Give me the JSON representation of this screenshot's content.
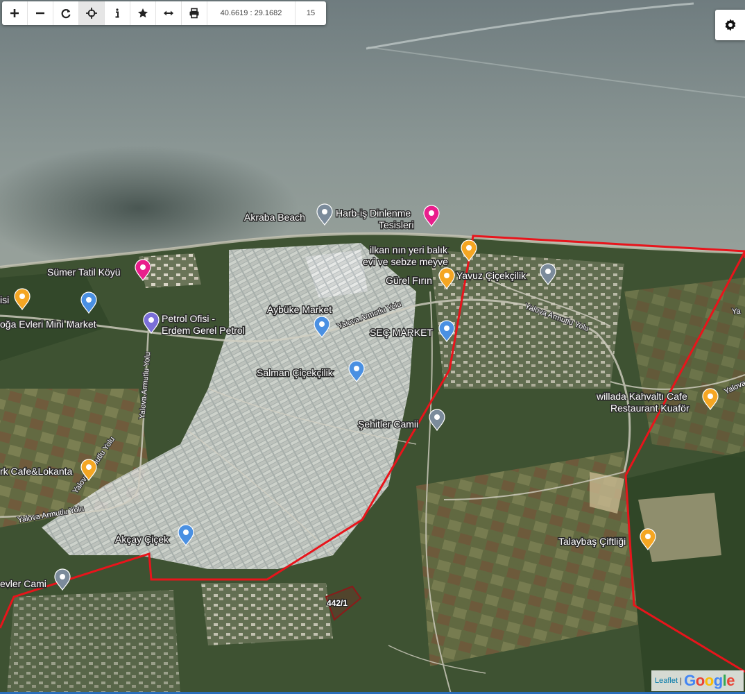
{
  "toolbar": {
    "buttons": [
      {
        "name": "zoom-in-icon",
        "glyph": "+"
      },
      {
        "name": "zoom-out-icon",
        "glyph": "−"
      },
      {
        "name": "refresh-icon",
        "glyph": "↻"
      },
      {
        "name": "locate-icon",
        "glyph": "crosshair"
      },
      {
        "name": "info-icon",
        "glyph": "i"
      },
      {
        "name": "star-icon",
        "glyph": "★"
      },
      {
        "name": "measure-icon",
        "glyph": "↔"
      },
      {
        "name": "print-icon",
        "glyph": "print"
      }
    ],
    "coordinates": "40.6619 : 29.1682",
    "zoom_level": "15"
  },
  "parcel_label": "442/1",
  "attribution": {
    "leaflet": "Leaflet",
    "separator": "|",
    "google": "Google"
  },
  "colors": {
    "boundary": "#e8141b",
    "parcel": "#8b1a1a",
    "food_pin": "#f5a623",
    "shop_pin": "#4a90e2",
    "lodging_pin": "#e91e8c",
    "place_pin": "#7b8b9b"
  },
  "pois": [
    {
      "label": "Akraba Beach",
      "type": "place"
    },
    {
      "label": "Harb-iş Dinlenme",
      "label2": "Tesisleri",
      "type": "lodging"
    },
    {
      "label": "ilkan nın yeri balık",
      "label2": "evi ve sebze meyve",
      "type": "food"
    },
    {
      "label": "Gürel Fırın",
      "type": "food"
    },
    {
      "label": "Yavuz Çiçekçilik",
      "type": "place"
    },
    {
      "label": "Sümer Tatil Köyü",
      "type": "lodging"
    },
    {
      "label": "isi",
      "type": "food"
    },
    {
      "label": "oğa Evleri Mini Market",
      "type": "shop"
    },
    {
      "label": "Petrol Ofisi -",
      "label2": "Erdem Gerel Petrol",
      "type": "fuel"
    },
    {
      "label": "Aybüke Market",
      "type": "shop"
    },
    {
      "label": "SEÇ MARKET",
      "type": "shop"
    },
    {
      "label": "Salman Çiçekçilik",
      "type": "shop"
    },
    {
      "label": "Şehitler Camii",
      "type": "mosque"
    },
    {
      "label": "willada Kahvaltı Cafe",
      "label2": "Restaurant Kuaför",
      "type": "food"
    },
    {
      "label": "rk Cafe&Lokanta",
      "type": "food"
    },
    {
      "label": "Akçay Çiçek",
      "type": "shop"
    },
    {
      "label": "Talaybaş Çiftliği",
      "type": "food"
    },
    {
      "label": "evler Cami",
      "type": "mosque"
    }
  ],
  "roads": [
    {
      "label": "Yalova Armutlu Yolu"
    },
    {
      "label": "Yalova Armutlu Yolu"
    },
    {
      "label": "Yalova Armutlu Yolu"
    },
    {
      "label": "Yalova Armutlu Yolu"
    },
    {
      "label": "Yalova Armutlu Yolu"
    },
    {
      "label": "Yalova"
    },
    {
      "label": "Ya"
    }
  ]
}
